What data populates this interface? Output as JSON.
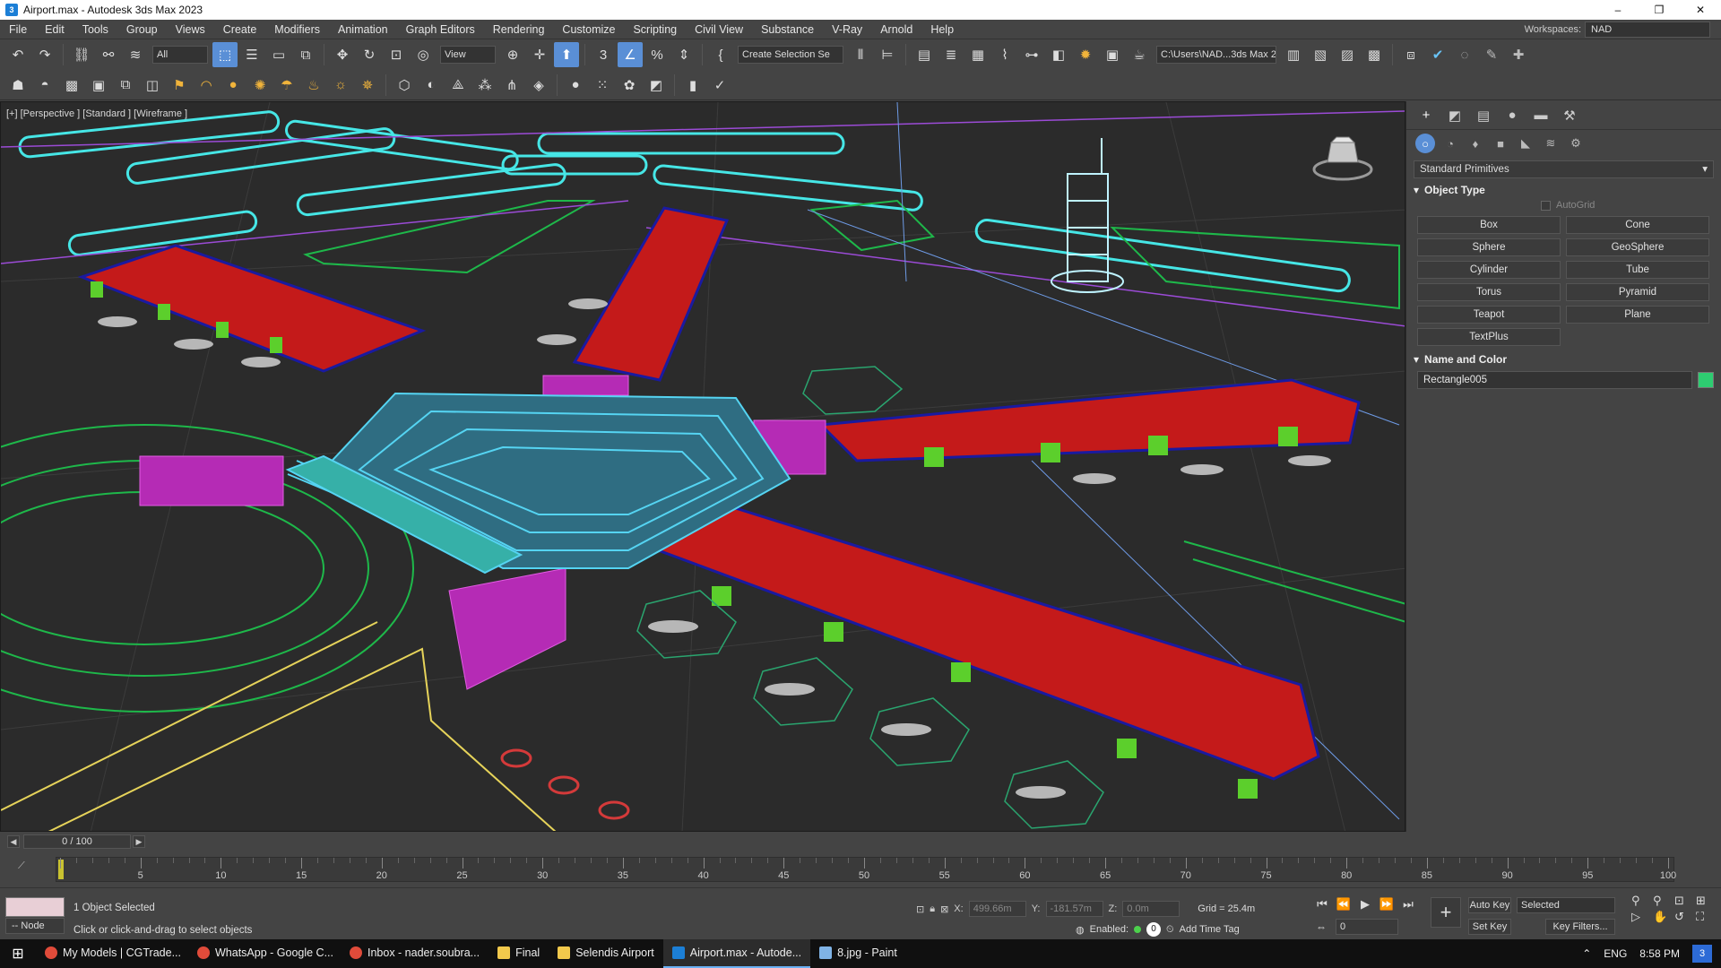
{
  "window": {
    "title": "Airport.max - Autodesk 3ds Max 2023",
    "minimize": "–",
    "maximize": "❐",
    "close": "✕"
  },
  "menu": [
    "File",
    "Edit",
    "Tools",
    "Group",
    "Views",
    "Create",
    "Modifiers",
    "Animation",
    "Graph Editors",
    "Rendering",
    "Customize",
    "Scripting",
    "Civil View",
    "Substance",
    "V-Ray",
    "Arnold",
    "Help"
  ],
  "workspaces": {
    "label": "Workspaces:",
    "value": "NAD"
  },
  "toolbar": {
    "selection_filter": "All",
    "ref_coord": "View",
    "named_selection": "Create Selection Se",
    "project_path": "C:\\Users\\NAD...3ds Max 2023"
  },
  "viewport": {
    "label": "[+] [Perspective ] [Standard ] [Wireframe ]"
  },
  "command_panel": {
    "category": "Standard Primitives",
    "object_type_title": "Object Type",
    "autogrid": "AutoGrid",
    "buttons": [
      "Box",
      "Cone",
      "Sphere",
      "GeoSphere",
      "Cylinder",
      "Tube",
      "Torus",
      "Pyramid",
      "Teapot",
      "Plane",
      "TextPlus"
    ],
    "name_color_title": "Name and Color",
    "object_name": "Rectangle005",
    "object_color": "#2ecc71"
  },
  "timeline": {
    "frame_display": "0 / 100",
    "ticks": [
      "0",
      "5",
      "10",
      "15",
      "20",
      "25",
      "30",
      "35",
      "40",
      "45",
      "50",
      "55",
      "60",
      "65",
      "70",
      "75",
      "80",
      "85",
      "90",
      "95",
      "100"
    ]
  },
  "status": {
    "selection": "1 Object Selected",
    "prompt": "Click or click-and-drag to select objects",
    "node": "-- Node",
    "x_label": "X:",
    "x": "499.66m",
    "y_label": "Y:",
    "y": "-181.57m",
    "z_label": "Z:",
    "z": "0.0m",
    "grid": "Grid = 25.4m",
    "enabled": "Enabled:",
    "add_time_tag": "Add Time Tag",
    "frame": "0",
    "auto_key": "Auto Key",
    "set_key": "Set Key",
    "key_mode": "Selected",
    "key_filters": "Key Filters..."
  },
  "taskbar": {
    "items": [
      {
        "label": "My Models | CGTrade...",
        "color": "#e04b3a"
      },
      {
        "label": "WhatsApp - Google C...",
        "color": "#e04b3a"
      },
      {
        "label": "Inbox - nader.soubra...",
        "color": "#e04b3a"
      },
      {
        "label": "Final",
        "color": "#f2c94c"
      },
      {
        "label": "Selendis Airport",
        "color": "#f2c94c"
      },
      {
        "label": "Airport.max - Autode...",
        "color": "#1c7fd6"
      },
      {
        "label": "8.jpg - Paint",
        "color": "#7fb3e6"
      }
    ],
    "lang": "ENG",
    "time": "8:58 PM",
    "notifications": "3"
  }
}
